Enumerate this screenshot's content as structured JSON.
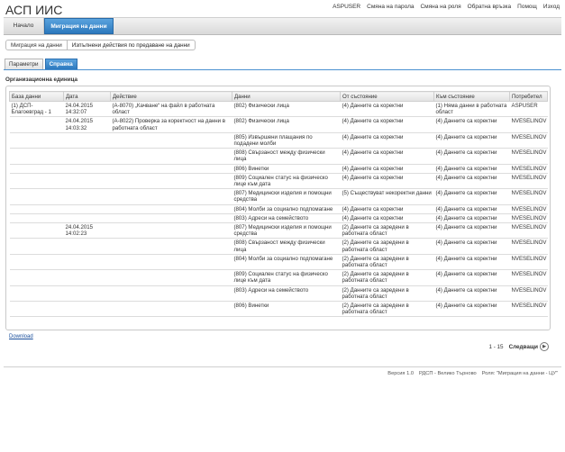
{
  "app_title": "АСП ИИС",
  "top_nav": [
    "ASPUSER",
    "Смяна на парола",
    "Смяна на роля",
    "Обратна връзка",
    "Помощ",
    "Изход"
  ],
  "menu": {
    "home": "Начало",
    "active": "Миграция на данни"
  },
  "breadcrumb": {
    "parent": "Миграция на данни",
    "current": "Изпълнени действия по предаване на данни"
  },
  "subtabs": {
    "params": "Параметри",
    "list": "Справка"
  },
  "org_label": "Организационна единица",
  "table": {
    "headers": [
      "База данни",
      "Дата",
      "Действие",
      "Данни",
      "От състояние",
      "Към състояние",
      "Потребител"
    ],
    "rows": [
      [
        "(1) ДСП-Благоевград - 1",
        "24.04.2015 14:32:07",
        "(A-8070) „Качване“ на файл в работната област",
        "(802) Физически лица",
        "(4) Данните са коректни",
        "(1) Няма данни в работната област",
        "ASPUSER"
      ],
      [
        "",
        "24.04.2015 14:03:32",
        "(A-8022) Проверка за коректност на данни в работната област",
        "(802) Физически лица",
        "(4) Данните са коректни",
        "(4) Данните са коректни",
        "NVESELINOV"
      ],
      [
        "",
        "",
        "",
        "(805) Извършени плащания по подадени молби",
        "(4) Данните са коректни",
        "(4) Данните са коректни",
        "NVESELINOV"
      ],
      [
        "",
        "",
        "",
        "(808) Свързаност между физически лица",
        "(4) Данните са коректни",
        "(4) Данните са коректни",
        "NVESELINOV"
      ],
      [
        "",
        "",
        "",
        "(806) Винетки",
        "(4) Данните са коректни",
        "(4) Данните са коректни",
        "NVESELINOV"
      ],
      [
        "",
        "",
        "",
        "(809) Социален статус на физическо лице към дата",
        "(4) Данните са коректни",
        "(4) Данните са коректни",
        "NVESELINOV"
      ],
      [
        "",
        "",
        "",
        "(807) Медицински изделия и помощни средства",
        "(5) Съществуват некоректни данни",
        "(4) Данните са коректни",
        "NVESELINOV"
      ],
      [
        "",
        "",
        "",
        "(804) Молби за социално подпомагане",
        "(4) Данните са коректни",
        "(4) Данните са коректни",
        "NVESELINOV"
      ],
      [
        "",
        "",
        "",
        "(803) Адреси на семейството",
        "(4) Данните са коректни",
        "(4) Данните са коректни",
        "NVESELINOV"
      ],
      [
        "",
        "24.04.2015 14:02:23",
        "",
        "(807) Медицински изделия и помощни средства",
        "(2) Данните са заредени в работната област",
        "(4) Данните са коректни",
        "NVESELINOV"
      ],
      [
        "",
        "",
        "",
        "(808) Свързаност между физически лица",
        "(2) Данните са заредени в работната област",
        "(4) Данните са коректни",
        "NVESELINOV"
      ],
      [
        "",
        "",
        "",
        "(804) Молби за социално подпомагане",
        "(2) Данните са заредени в работната област",
        "(4) Данните са коректни",
        "NVESELINOV"
      ],
      [
        "",
        "",
        "",
        "(809) Социален статус на физическо лице към дата",
        "(2) Данните са заредени в работната област",
        "(4) Данните са коректни",
        "NVESELINOV"
      ],
      [
        "",
        "",
        "",
        "(803) Адреси на семейството",
        "(2) Данните са заредени в работната област",
        "(4) Данните са коректни",
        "NVESELINOV"
      ],
      [
        "",
        "",
        "",
        "(806) Винетки",
        "(2) Данните са заредени в работната област",
        "(4) Данните са коректни",
        "NVESELINOV"
      ]
    ]
  },
  "download_label": "Download",
  "pager": {
    "range": "1 - 15",
    "next": "Следващи"
  },
  "footer": {
    "version": "Версия 1.0",
    "org": "РДСП - Велико Търново",
    "role": "Роля: \"Миграция на данни - ЦУ\""
  }
}
